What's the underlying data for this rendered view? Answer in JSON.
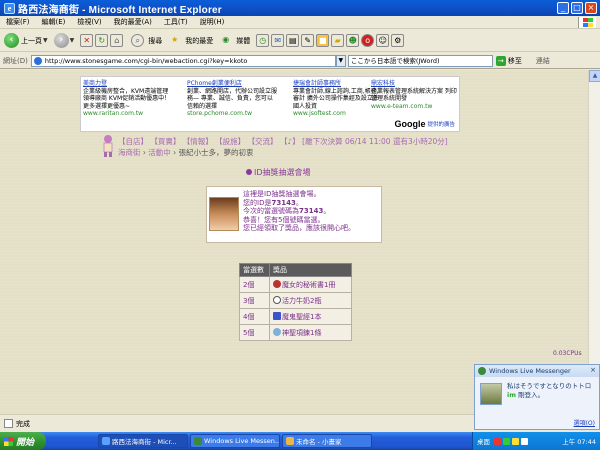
{
  "window": {
    "title": "路西法海商街 - Microsoft Internet Explorer",
    "app_icon_glyph": "e"
  },
  "menu": [
    "檔案(F)",
    "編輯(E)",
    "檢視(V)",
    "我的最愛(A)",
    "工具(T)",
    "說明(H)"
  ],
  "toolbar": {
    "back": "上一頁",
    "search": "搜尋",
    "favorites": "我的最愛",
    "media": "媒體"
  },
  "address": {
    "label": "網址(D)",
    "url": "http://www.stonesgame.com/cgi-bin/webaction.cgi?key=kkoto",
    "search_text": "ここから日本語で検索(JWord)",
    "go": "移至",
    "links": "連結"
  },
  "ads": [
    {
      "title": "美商力登",
      "body": "企業級機房整合，KVM遠端管理 領導廠商 KVM促銷活動優惠中！更多選擇更優惠~",
      "url": "www.raritan.com.tw"
    },
    {
      "title": "PChome創業便利店",
      "body": "創業、網路開店，代辦公司設立服務— 專業、誠信、負責，您可以信賴的選擇",
      "url": "store.pchome.com.tw"
    },
    {
      "title": "捷瑞會計師事務所",
      "body": "專業會計師,線上諮詢,工商,帳務,審計 擴外公司操作集經及設立外國人投資",
      "url": "www.jsoftest.com"
    },
    {
      "title": "鼎宏科技",
      "body": "企業報表管理系統解決方案 列印管理系統開發",
      "url": "www.e-team.com.tw"
    }
  ],
  "google": {
    "logo": "Google",
    "text": "提供的廣告"
  },
  "nav": {
    "items": [
      "【自店】",
      "【買賣】",
      "【情報】",
      "【設施】",
      "【交流】",
      "【♪】"
    ],
    "countdown": "[離下次決算 06/14 11:00 還有3小時20分]",
    "breadcrumb": [
      "海商街",
      "活動中",
      "張紀小士多，夢的初衷"
    ]
  },
  "section_title": "ID抽獎抽選會場",
  "info": {
    "line1": "這裡是ID抽獎抽選會場。",
    "line2_pre": "您的ID是",
    "line2_id": "73143",
    "line2_post": "。",
    "line3_pre": "今次的當選號碼為",
    "line3_id": "73143",
    "line3_post": "。",
    "line4": "恭喜！您有5個號碼當選。",
    "line5": "您已經領取了獎品，應該很開心吧。"
  },
  "prizes": {
    "headers": [
      "當選數",
      "獎品"
    ],
    "rows": [
      {
        "amount": "2個",
        "prize": "魔女的秘術書1冊",
        "icon_color": "#b8332f"
      },
      {
        "amount": "3個",
        "prize": "活力牛奶2瓶",
        "icon_color": "#ffffff"
      },
      {
        "amount": "4個",
        "prize": "魔鬼聖經1本",
        "icon_color": "#3b55c8"
      },
      {
        "amount": "5個",
        "prize": "神聖項鍊1條",
        "icon_color": "#7fb2d8"
      }
    ]
  },
  "cpu": "0.03CPUs",
  "messenger": {
    "title": "Windows Live Messenger",
    "message_pre": "私はそうですとなりのトトロ",
    "message_im": "im",
    "message_post": " 剛登入。",
    "options": "選項(O)"
  },
  "status": {
    "text": "完成"
  },
  "taskbar": {
    "start": "開始",
    "tasks": [
      "路西法海商街 - Micr...",
      "Windows Live Messen...",
      "未命名 - 小畫家"
    ],
    "tray_label": "桌面",
    "clock": "上午 07:44"
  }
}
